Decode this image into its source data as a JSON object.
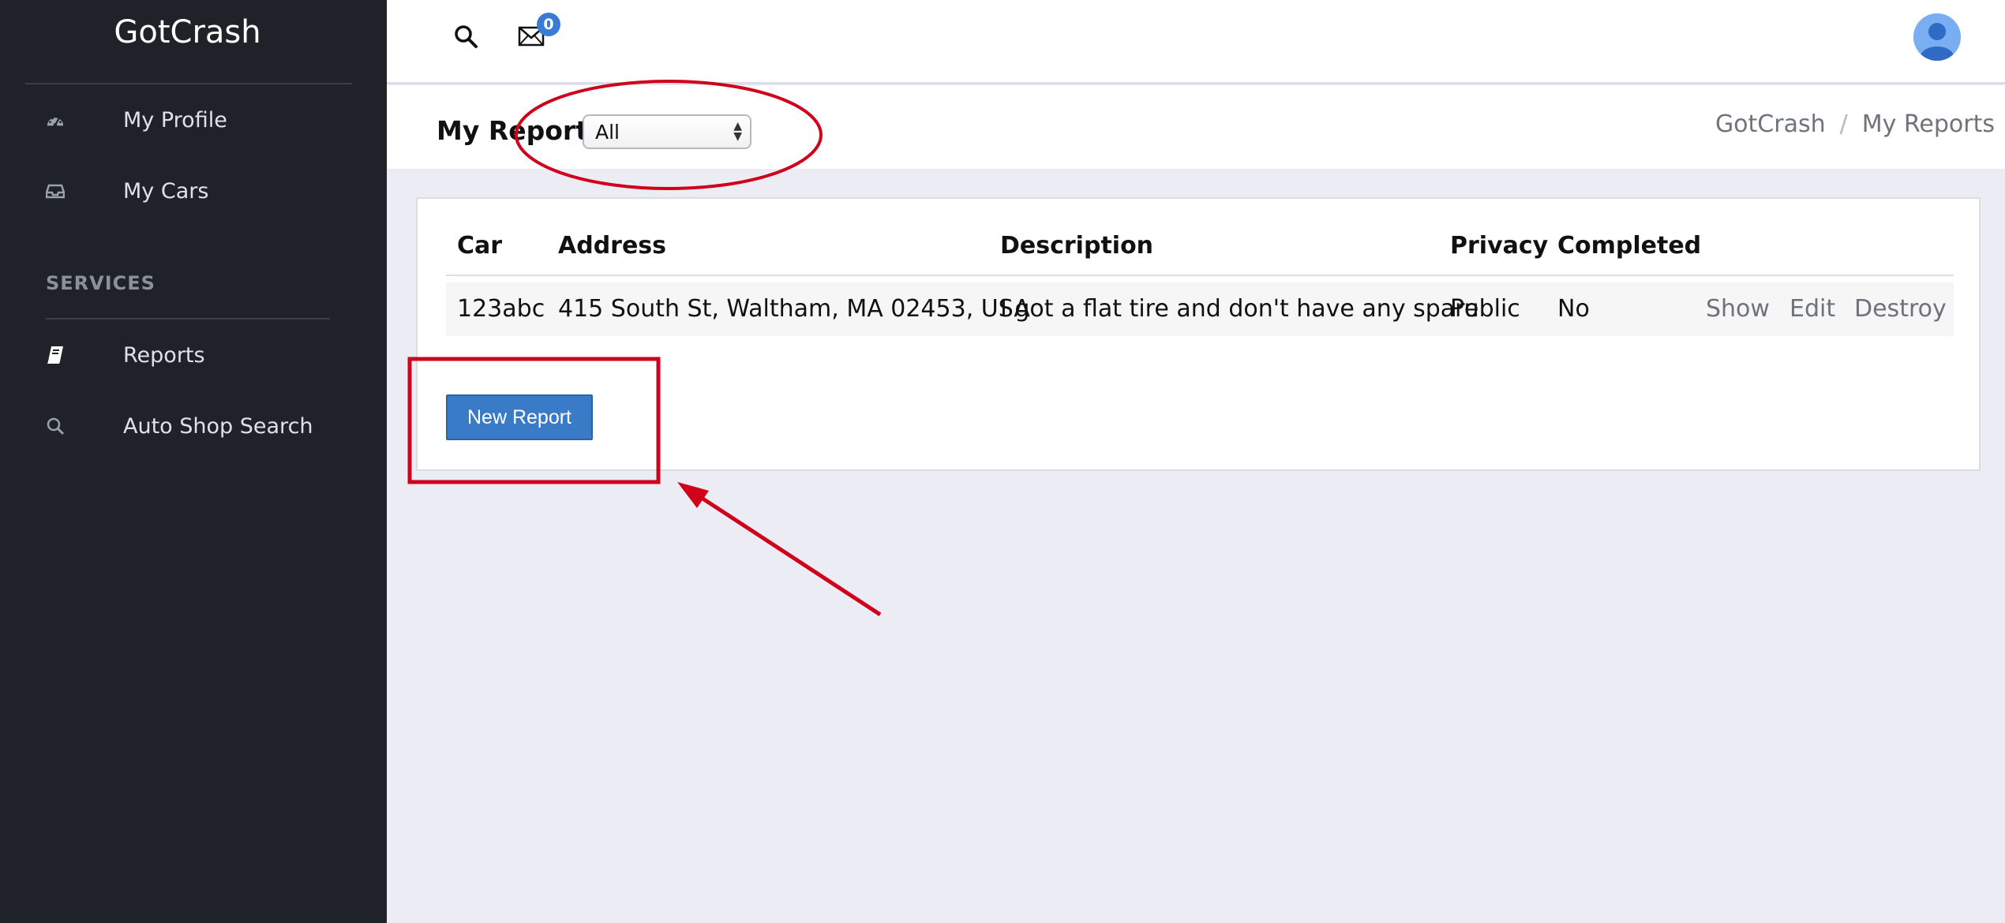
{
  "app": {
    "brand": "GotCrash"
  },
  "sidebar": {
    "items": [
      {
        "label": "My Profile",
        "icon": "dashboard-icon"
      },
      {
        "label": "My Cars",
        "icon": "inbox-icon"
      }
    ],
    "section_label": "SERVICES",
    "service_items": [
      {
        "label": "Reports",
        "icon": "book-icon"
      },
      {
        "label": "Auto Shop Search",
        "icon": "search-icon"
      }
    ]
  },
  "topbar": {
    "mail_badge": "0",
    "icons": [
      "search-icon",
      "mail-icon",
      "user-avatar"
    ]
  },
  "page": {
    "title": "My Reports",
    "filter": {
      "selected": "All"
    },
    "breadcrumb": [
      "GotCrash",
      "My Reports"
    ],
    "breadcrumb_separator": "/"
  },
  "table": {
    "columns": [
      "Car",
      "Address",
      "Description",
      "Privacy",
      "Completed"
    ],
    "rows": [
      {
        "car": "123abc",
        "address": "415 South St, Waltham, MA 02453, USA",
        "description": "I got a flat tire and don't have any spare",
        "privacy": "Public",
        "completed": "No",
        "actions": [
          "Show",
          "Edit",
          "Destroy"
        ]
      }
    ]
  },
  "new_report_button": "New Report",
  "colors": {
    "sidebar_bg": "#1f2329",
    "accent": "#3a7bc8",
    "annotation": "#d0021b",
    "page_bg": "#ececf4"
  }
}
